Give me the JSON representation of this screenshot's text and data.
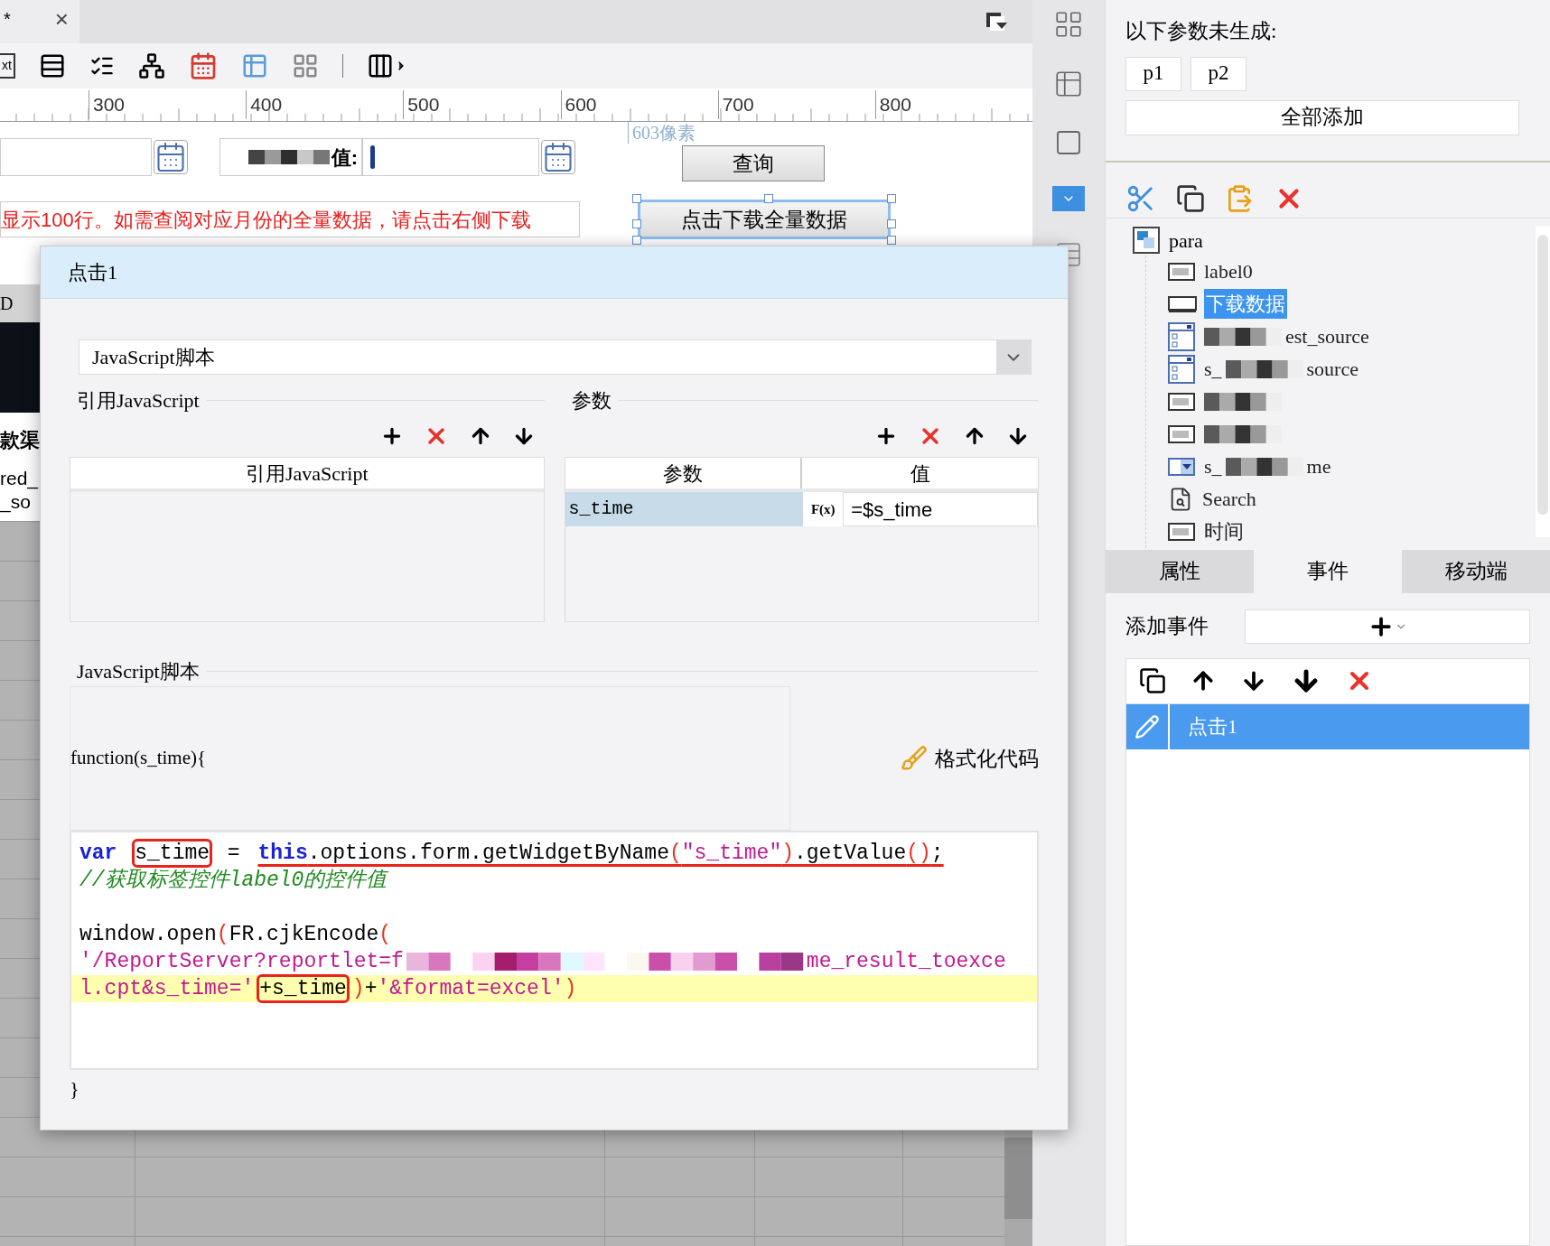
{
  "editor_tab": {
    "modified_mark": "*",
    "close": "×"
  },
  "toolbar": {
    "text_widget_label": "xt"
  },
  "ruler": {
    "labels": [
      "300",
      "400",
      "500",
      "600",
      "700",
      "800"
    ]
  },
  "canvas": {
    "guide_label": "603像素",
    "field_label": "值:",
    "query_button": "查询",
    "notice": "显示100行。如需查阅对应月份的全量数据，请点击右侧下载",
    "download_button": {
      "label": "点击下载全量数据",
      "selected": true
    },
    "report_fragments": [
      "D",
      "款渠",
      "red_",
      "_so"
    ]
  },
  "dialog": {
    "title": "点击1",
    "script_type": "JavaScript脚本",
    "ref_section": {
      "title": "引用JavaScript",
      "column": "引用JavaScript"
    },
    "param_section": {
      "title": "参数",
      "columns": [
        "参数",
        "值"
      ],
      "rows": [
        {
          "name": "s_time",
          "formula": "F(x)",
          "value": "=$s_time",
          "selected": true
        }
      ]
    },
    "script_section": {
      "title": "JavaScript脚本",
      "signature": "function(s_time){",
      "format_button": "格式化代码",
      "closing": "}"
    },
    "code_lines": [
      {
        "kind": "code",
        "highlighted": false,
        "runs": [
          {
            "boxed": false,
            "underlined": false,
            "tokens": [
              {
                "kind": "kw",
                "text": "var "
              }
            ]
          },
          {
            "boxed": true,
            "underlined": false,
            "tokens": [
              {
                "kind": "plain",
                "text": "s_time"
              }
            ]
          },
          {
            "boxed": false,
            "underlined": false,
            "tokens": [
              {
                "kind": "plain",
                "text": " = "
              }
            ]
          },
          {
            "boxed": false,
            "underlined": true,
            "tokens": [
              {
                "kind": "kw",
                "text": "this"
              },
              {
                "kind": "plain",
                "text": ".options.form.getWidgetByName"
              },
              {
                "kind": "paren",
                "text": "("
              },
              {
                "kind": "str",
                "text": "\"s_time\""
              },
              {
                "kind": "paren",
                "text": ")"
              },
              {
                "kind": "plain",
                "text": ".getValue"
              },
              {
                "kind": "paren",
                "text": "()"
              },
              {
                "kind": "plain",
                "text": ";"
              }
            ]
          }
        ]
      },
      {
        "kind": "code",
        "highlighted": false,
        "runs": [
          {
            "boxed": false,
            "underlined": false,
            "tokens": [
              {
                "kind": "comment",
                "text": "//获取标签控件label0的控件值"
              }
            ]
          }
        ]
      },
      {
        "kind": "blank"
      },
      {
        "kind": "code",
        "highlighted": false,
        "runs": [
          {
            "boxed": false,
            "underlined": false,
            "tokens": [
              {
                "kind": "plain",
                "text": "window.open"
              },
              {
                "kind": "paren",
                "text": "("
              },
              {
                "kind": "plain",
                "text": "FR.cjkEncode"
              },
              {
                "kind": "paren",
                "text": "("
              }
            ]
          }
        ]
      },
      {
        "kind": "code",
        "highlighted": false,
        "runs": [
          {
            "boxed": false,
            "underlined": false,
            "tokens": [
              {
                "kind": "str",
                "text": "'/ReportServer?reportlet=f"
              }
            ]
          },
          {
            "kind": "redacted"
          },
          {
            "boxed": false,
            "underlined": false,
            "tokens": [
              {
                "kind": "str",
                "text": "me_result_toexce"
              }
            ]
          }
        ]
      },
      {
        "kind": "code",
        "highlighted": true,
        "runs": [
          {
            "boxed": false,
            "underlined": false,
            "tokens": [
              {
                "kind": "str",
                "text": "l.cpt&s_time='"
              }
            ]
          },
          {
            "boxed": true,
            "underlined": false,
            "tokens": [
              {
                "kind": "plain",
                "text": "+s_time"
              }
            ]
          },
          {
            "boxed": false,
            "underlined": false,
            "tokens": [
              {
                "kind": "paren",
                "text": ")"
              },
              {
                "kind": "plain",
                "text": "+"
              },
              {
                "kind": "str",
                "text": "'&format=excel'"
              },
              {
                "kind": "paren",
                "text": ")"
              }
            ]
          }
        ]
      }
    ]
  },
  "right_panel": {
    "missing_params_title": "以下参数未生成:",
    "missing_params": [
      "p1",
      "p2"
    ],
    "add_all": "全部添加",
    "tree": {
      "label": "para",
      "children": [
        {
          "kind": "label",
          "parts": [
            {
              "kind": "text",
              "text": "label0"
            }
          ],
          "selected": false
        },
        {
          "kind": "button",
          "parts": [
            {
              "kind": "text",
              "text": "下载数据"
            }
          ],
          "selected": true
        },
        {
          "kind": "combo",
          "parts": [
            {
              "kind": "redacted"
            },
            {
              "kind": "text",
              "text": "est_source"
            }
          ],
          "selected": false
        },
        {
          "kind": "combo",
          "parts": [
            {
              "kind": "text",
              "text": "s_"
            },
            {
              "kind": "redacted"
            },
            {
              "kind": "text",
              "text": "source"
            }
          ],
          "selected": false
        },
        {
          "kind": "label",
          "parts": [
            {
              "kind": "redacted"
            }
          ],
          "selected": false
        },
        {
          "kind": "label",
          "parts": [
            {
              "kind": "redacted"
            }
          ],
          "selected": false
        },
        {
          "kind": "dropdown",
          "parts": [
            {
              "kind": "text",
              "text": "s_"
            },
            {
              "kind": "redacted"
            },
            {
              "kind": "text",
              "text": "me"
            }
          ],
          "selected": false
        },
        {
          "kind": "search",
          "parts": [
            {
              "kind": "text",
              "text": "Search"
            }
          ],
          "selected": false
        },
        {
          "kind": "label",
          "parts": [
            {
              "kind": "text",
              "text": "时间"
            }
          ],
          "selected": false
        }
      ]
    },
    "tabs": [
      {
        "label": "属性",
        "selected": false
      },
      {
        "label": "事件",
        "selected": true
      },
      {
        "label": "移动端",
        "selected": false
      }
    ],
    "add_event_label": "添加事件",
    "events": [
      {
        "label": "点击1",
        "selected": true
      }
    ]
  }
}
